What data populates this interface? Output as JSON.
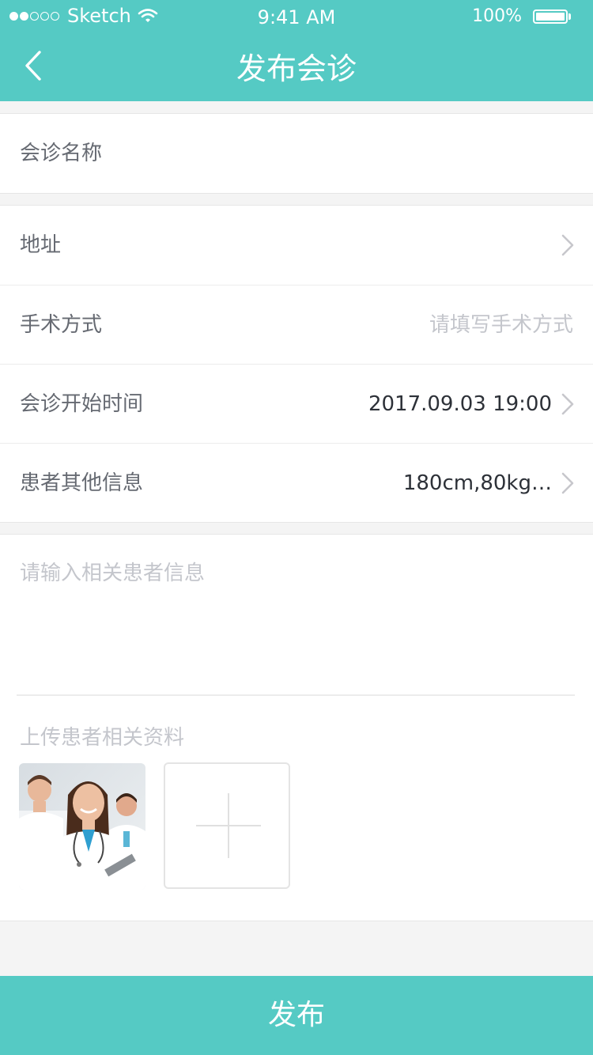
{
  "status_bar": {
    "carrier": "Sketch",
    "time": "9:41 AM",
    "battery": "100%"
  },
  "nav": {
    "title": "发布会诊"
  },
  "form": {
    "name_placeholder": "会诊名称",
    "address_label": "地址",
    "surgery_label": "手术方式",
    "surgery_placeholder": "请填写手术方式",
    "start_time_label": "会诊开始时间",
    "start_time_value": "2017.09.03 19:00",
    "patient_info_label": "患者其他信息",
    "patient_info_value": "180cm,80kg…",
    "patient_detail_placeholder": "请输入相关患者信息",
    "upload_label": "上传患者相关资料"
  },
  "publish_button": "发布",
  "colors": {
    "brand": "#55cac4",
    "background": "#f4f4f4"
  },
  "icons": [
    "back-chevron-icon",
    "chevron-right-icon",
    "wifi-icon",
    "battery-icon",
    "plus-icon"
  ]
}
